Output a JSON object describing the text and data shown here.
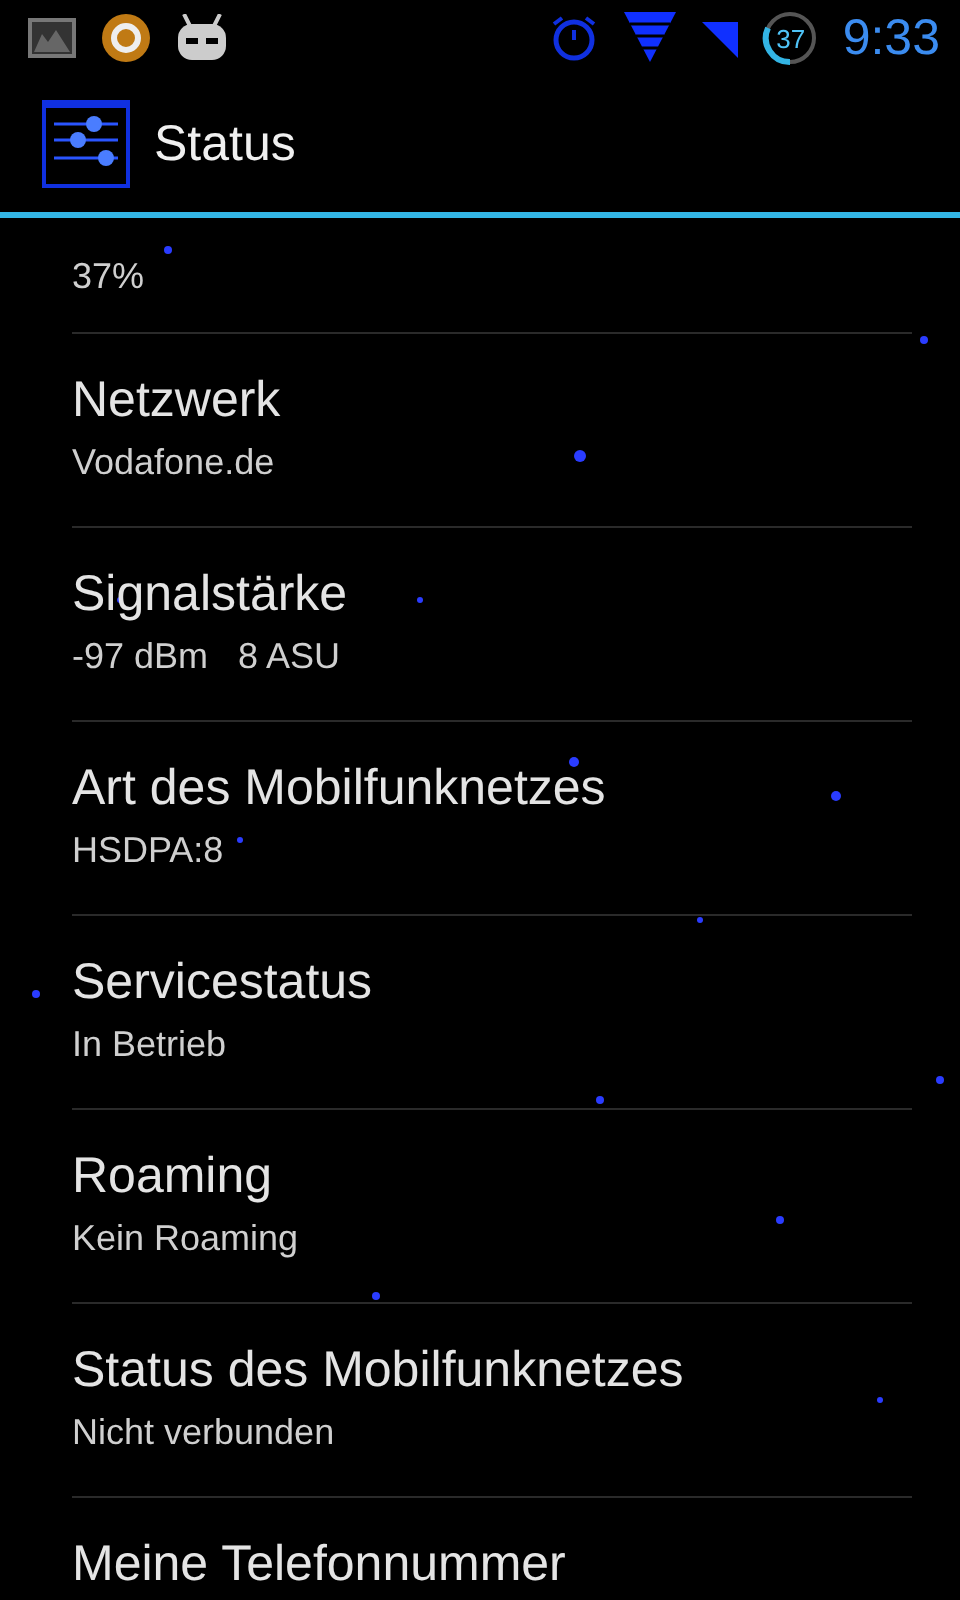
{
  "status_bar": {
    "battery": "37",
    "time": "9:33"
  },
  "header": {
    "title": "Status"
  },
  "items": [
    {
      "value": "37%"
    },
    {
      "title": "Netzwerk",
      "value": "Vodafone.de"
    },
    {
      "title": "Signalstärke",
      "value": "-97 dBm   8 ASU"
    },
    {
      "title": "Art des Mobilfunknetzes",
      "value": "HSDPA:8"
    },
    {
      "title": "Servicestatus",
      "value": "In Betrieb"
    },
    {
      "title": "Roaming",
      "value": "Kein Roaming"
    },
    {
      "title": "Status des Mobilfunknetzes",
      "value": "Nicht verbunden"
    },
    {
      "title": "Meine Telefonnummer"
    }
  ]
}
